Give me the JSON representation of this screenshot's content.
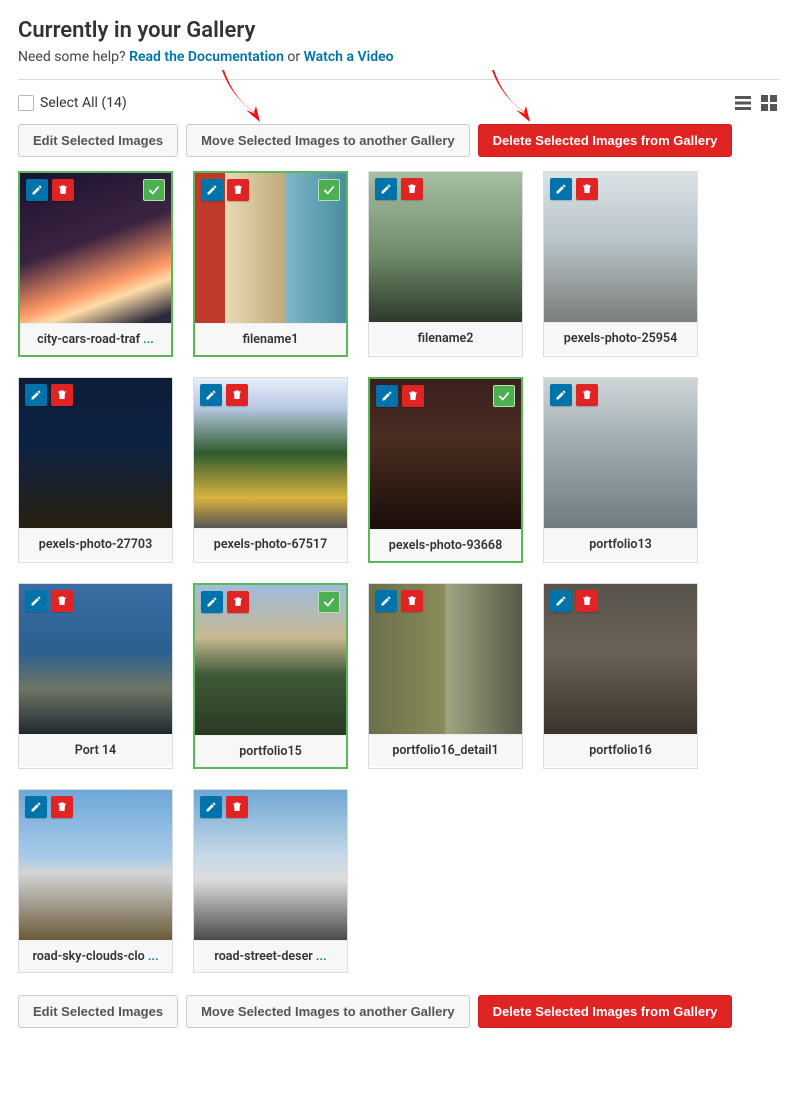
{
  "header": {
    "title": "Currently in your Gallery",
    "help_prefix": "Need some help? ",
    "doc_link": "Read the Documentation",
    "help_middle": " or ",
    "video_link": "Watch a Video"
  },
  "toolbar": {
    "select_all_label": "Select All (14)"
  },
  "actions": {
    "edit": "Edit Selected Images",
    "move": "Move Selected Images to another Gallery",
    "delete": "Delete Selected Images from Gallery"
  },
  "items": [
    {
      "label": "city-cars-road-traf",
      "truncated": true,
      "selected": true
    },
    {
      "label": "filename1",
      "truncated": false,
      "selected": true
    },
    {
      "label": "filename2",
      "truncated": false,
      "selected": false
    },
    {
      "label": "pexels-photo-25954",
      "truncated": false,
      "selected": false
    },
    {
      "label": "pexels-photo-27703",
      "truncated": false,
      "selected": false
    },
    {
      "label": "pexels-photo-67517",
      "truncated": false,
      "selected": false
    },
    {
      "label": "pexels-photo-93668",
      "truncated": false,
      "selected": true
    },
    {
      "label": "portfolio13",
      "truncated": false,
      "selected": false
    },
    {
      "label": "Port 14",
      "truncated": false,
      "selected": false
    },
    {
      "label": "portfolio15",
      "truncated": false,
      "selected": true
    },
    {
      "label": "portfolio16_detail1",
      "truncated": false,
      "selected": false
    },
    {
      "label": "portfolio16",
      "truncated": false,
      "selected": false
    },
    {
      "label": "road-sky-clouds-clo",
      "truncated": true,
      "selected": false
    },
    {
      "label": "road-street-deser",
      "truncated": true,
      "selected": false
    }
  ]
}
